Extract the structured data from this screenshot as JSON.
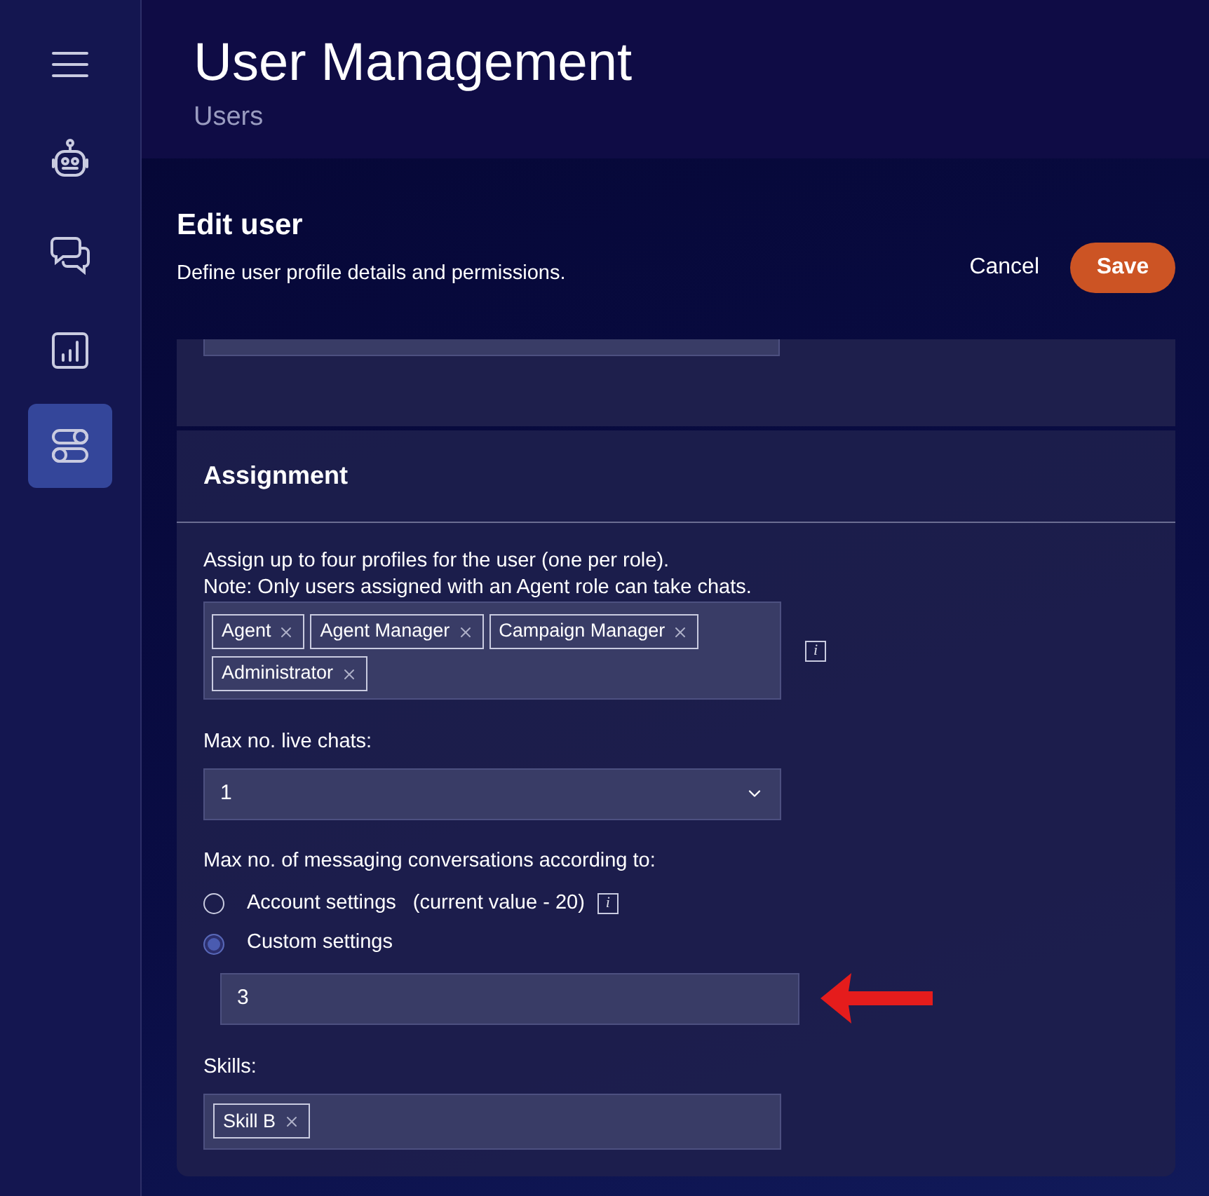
{
  "sidebar": {
    "items": [
      {
        "kind": "menu",
        "selected": false
      },
      {
        "kind": "bot",
        "selected": false
      },
      {
        "kind": "chats",
        "selected": false
      },
      {
        "kind": "reports",
        "selected": false
      },
      {
        "kind": "settings",
        "selected": true
      }
    ]
  },
  "header": {
    "title": "User Management",
    "subtitle": "Users"
  },
  "edit": {
    "title": "Edit user",
    "description": "Define user profile details and permissions.",
    "cancel": "Cancel",
    "save": "Save"
  },
  "assignment": {
    "title": "Assignment",
    "hint": [
      "Assign up to four profiles for the user (one per role).",
      "Note: Only users assigned with an Agent role can take chats."
    ],
    "profiles": [
      "Agent",
      "Agent Manager",
      "Campaign Manager",
      "Administrator"
    ],
    "profiles_info": "i",
    "live_chats": {
      "label": "Max no. live chats:",
      "value": "1"
    },
    "messaging": {
      "label": "Max no. of messaging conversations according to:",
      "options": [
        {
          "label": "Account settings",
          "note": "(current value - 20)",
          "selected": false,
          "info": "i"
        },
        {
          "label": "Custom settings",
          "selected": true
        }
      ],
      "custom_value": "3"
    },
    "skills": {
      "label": "Skills:",
      "tags": [
        "Skill B"
      ]
    }
  }
}
